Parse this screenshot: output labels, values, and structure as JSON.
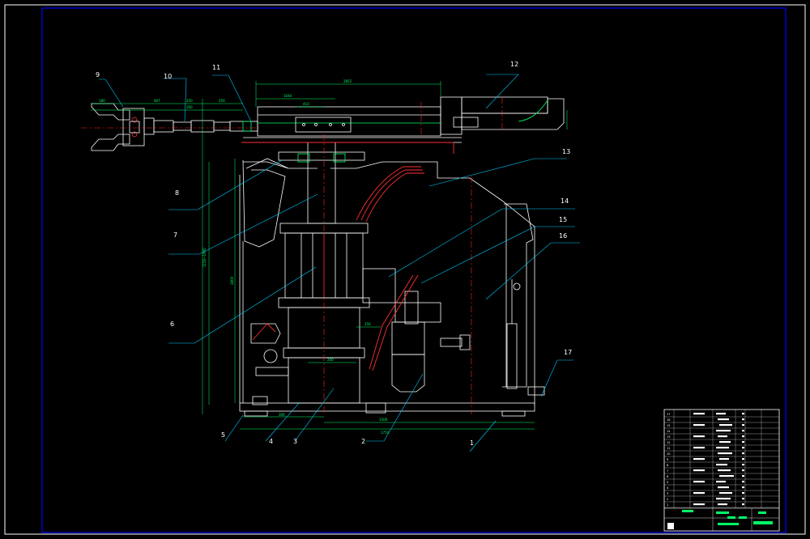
{
  "drawing": {
    "callouts": [
      "1",
      "2",
      "3",
      "4",
      "5",
      "6",
      "7",
      "8",
      "9",
      "10",
      "11",
      "12",
      "13",
      "14",
      "15",
      "16",
      "17"
    ],
    "colors": {
      "background": "#000000",
      "outline": "#ffffff",
      "frame": "#0000ff",
      "dimension": "#00ff66",
      "centerline": "#ff2020",
      "hydraulic": "#ff3030",
      "leader": "#00ccff",
      "callout_text": "#ffffff"
    }
  },
  "dimensions": {
    "top_overall": "2852",
    "top_a": "1040",
    "top_b": "410",
    "left_a": "180",
    "left_b": "467",
    "left_c": "250",
    "left_d": "250",
    "left_e": "200",
    "vertical_total": "1150~1900",
    "vertical_inner": "2800",
    "bottom_a": "300",
    "bottom_b": "1500",
    "bottom_overall": "1750",
    "mid_a": "200",
    "mid_b": "250"
  },
  "title_block": {
    "row_numbers": [
      "17",
      "16",
      "15",
      "14",
      "13",
      "12",
      "11",
      "10",
      "9",
      "8",
      "7",
      "6",
      "5",
      "4",
      "3",
      "2",
      "1"
    ]
  }
}
